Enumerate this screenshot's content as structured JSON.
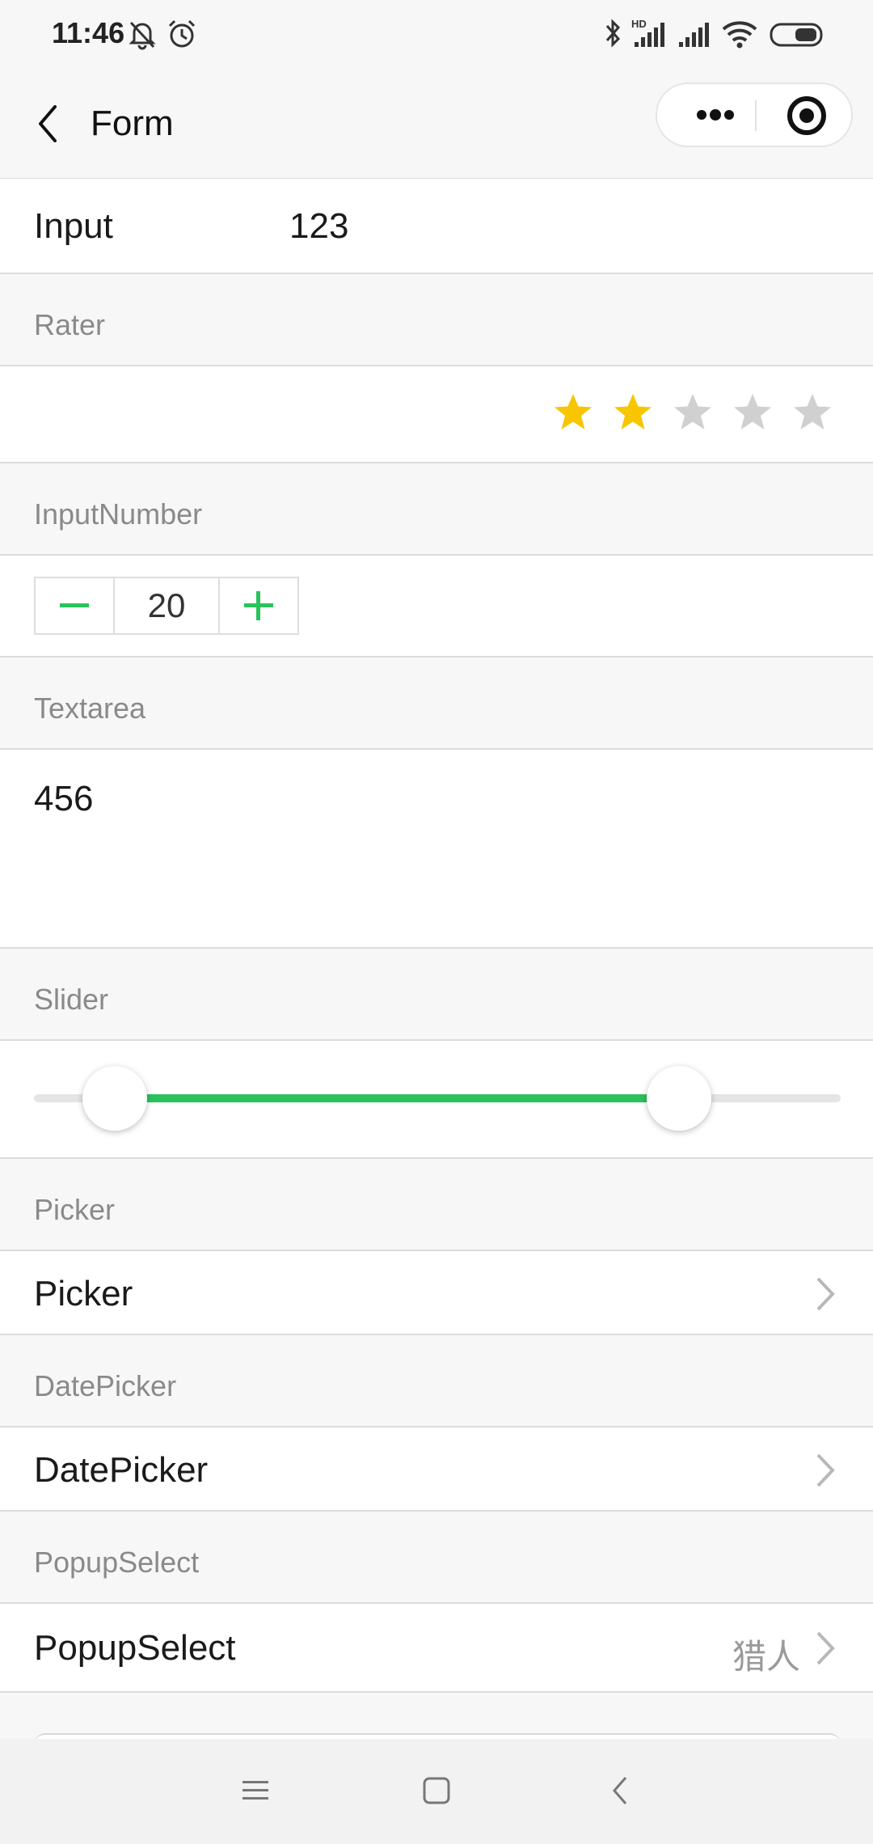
{
  "status_bar": {
    "time": "11:46",
    "left_icons": [
      "bell-off-icon",
      "alarm-icon"
    ],
    "right_icons": [
      "bluetooth-icon",
      "hd-signal-icon",
      "signal-icon",
      "wifi-icon",
      "battery-icon"
    ],
    "hd_label": "HD"
  },
  "header": {
    "title": "Form",
    "back_icon": "chevron-left-icon",
    "more_icon": "more-dots-icon",
    "target_icon": "target-icon"
  },
  "input": {
    "label": "Input",
    "value": "123"
  },
  "rater": {
    "section_title": "Rater",
    "rating": 2,
    "max": 5,
    "active_color": "#f7c600",
    "inactive_color": "#d0d0d0"
  },
  "input_number": {
    "section_title": "InputNumber",
    "value": "20",
    "minus": "−",
    "plus": "+"
  },
  "textarea": {
    "section_title": "Textarea",
    "value": "456"
  },
  "slider": {
    "section_title": "Slider",
    "range_start_fraction": 0.1,
    "range_end_fraction": 0.8,
    "accent": "#2bc25d"
  },
  "picker": {
    "section_title": "Picker",
    "label": "Picker"
  },
  "datepicker": {
    "section_title": "DatePicker",
    "label": "DatePicker"
  },
  "popupselect": {
    "section_title": "PopupSelect",
    "label": "PopupSelect",
    "value": "猎人"
  },
  "system_nav": {
    "icons": [
      "menu-icon",
      "home-icon",
      "back-icon"
    ]
  }
}
